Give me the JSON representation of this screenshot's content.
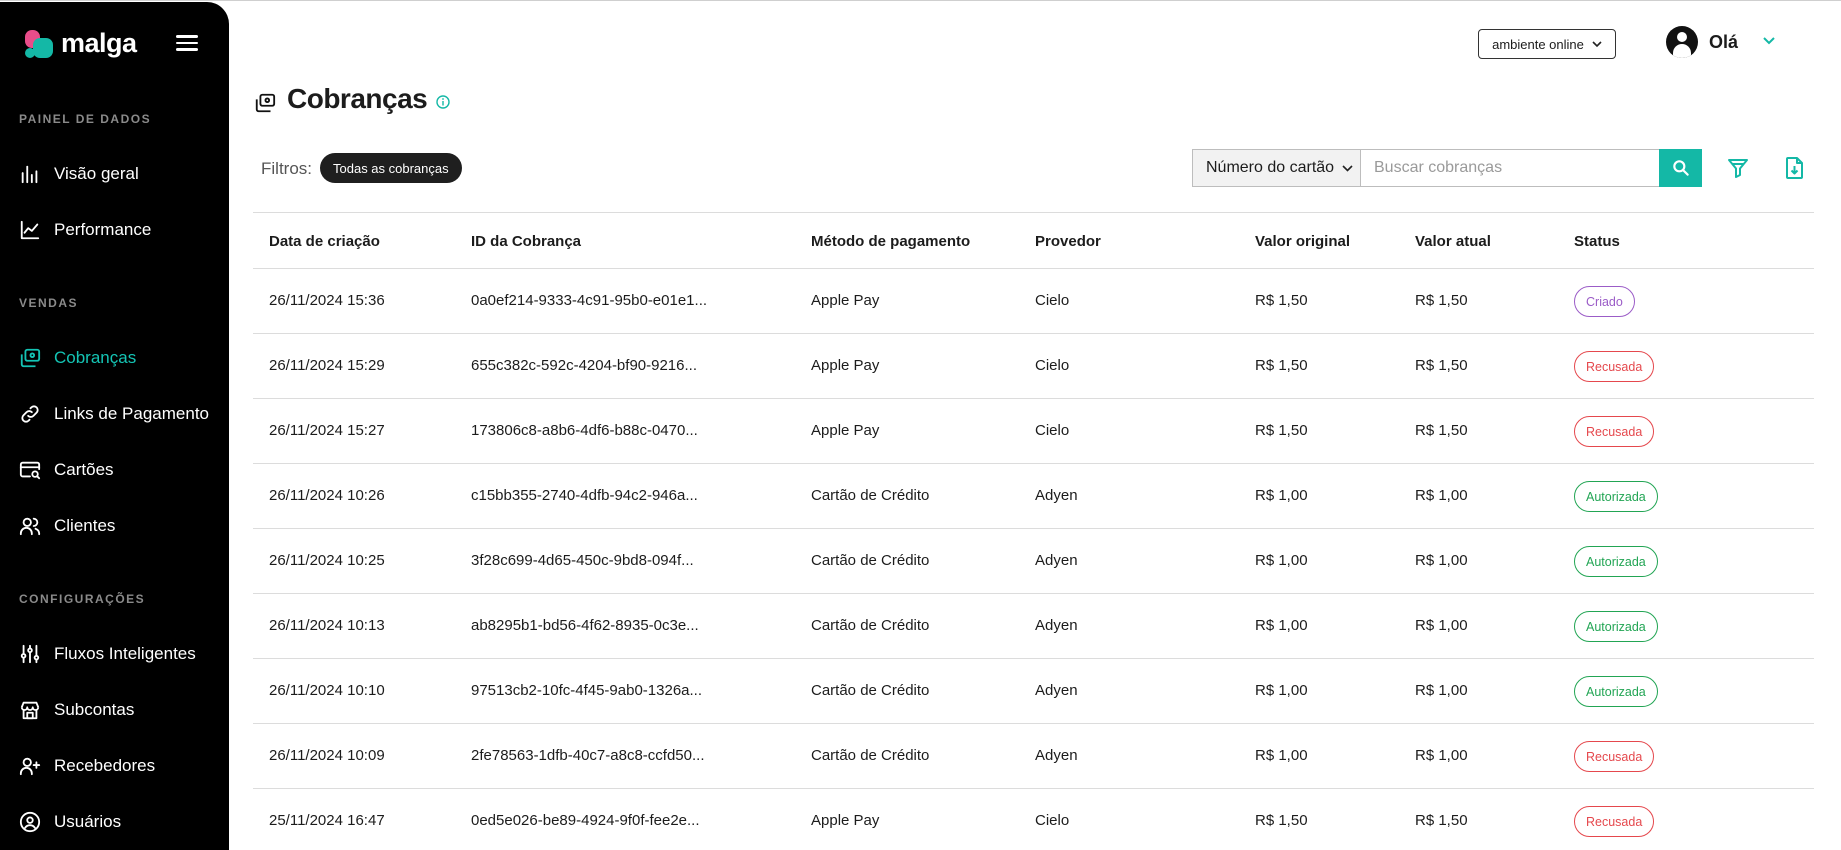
{
  "brand": {
    "name": "malga"
  },
  "colors": {
    "accent": "#14b8a6",
    "sidebar_bg": "#000000",
    "status_criado": "#9b5cc7",
    "status_recusada": "#e5484d",
    "status_autorizada": "#22a554"
  },
  "sidebar": {
    "sections": [
      {
        "title": "PAINEL DE DADOS",
        "items": [
          {
            "label": "Visão geral",
            "icon": "bar-chart-icon"
          },
          {
            "label": "Performance",
            "icon": "line-chart-icon"
          }
        ]
      },
      {
        "title": "VENDAS",
        "items": [
          {
            "label": "Cobranças",
            "icon": "charges-icon",
            "active": true
          },
          {
            "label": "Links de Pagamento",
            "icon": "link-icon"
          },
          {
            "label": "Cartões",
            "icon": "card-search-icon"
          },
          {
            "label": "Clientes",
            "icon": "users-icon"
          }
        ]
      },
      {
        "title": "CONFIGURAÇÕES",
        "items": [
          {
            "label": "Fluxos Inteligentes",
            "icon": "sliders-icon"
          },
          {
            "label": "Subcontas",
            "icon": "store-icon"
          },
          {
            "label": "Recebedores",
            "icon": "user-plus-icon"
          },
          {
            "label": "Usuários",
            "icon": "user-circle-icon"
          }
        ]
      }
    ]
  },
  "header": {
    "environment": "ambiente online",
    "greeting": "Olá"
  },
  "page": {
    "title": "Cobranças"
  },
  "filters": {
    "label": "Filtros:",
    "active_chip": "Todas as cobranças",
    "search_field": "Número do cartão",
    "search_placeholder": "Buscar cobranças"
  },
  "table": {
    "columns": [
      "Data de criação",
      "ID da Cobrança",
      "Método de pagamento",
      "Provedor",
      "Valor original",
      "Valor atual",
      "Status"
    ],
    "rows": [
      {
        "date": "26/11/2024 15:36",
        "id": "0a0ef214-9333-4c91-95b0-e01e1...",
        "method": "Apple Pay",
        "provider": "Cielo",
        "original": "R$ 1,50",
        "current": "R$ 1,50",
        "status": "Criado",
        "status_type": "criado"
      },
      {
        "date": "26/11/2024 15:29",
        "id": "655c382c-592c-4204-bf90-9216...",
        "method": "Apple Pay",
        "provider": "Cielo",
        "original": "R$ 1,50",
        "current": "R$ 1,50",
        "status": "Recusada",
        "status_type": "recusada"
      },
      {
        "date": "26/11/2024 15:27",
        "id": "173806c8-a8b6-4df6-b88c-0470...",
        "method": "Apple Pay",
        "provider": "Cielo",
        "original": "R$ 1,50",
        "current": "R$ 1,50",
        "status": "Recusada",
        "status_type": "recusada"
      },
      {
        "date": "26/11/2024 10:26",
        "id": "c15bb355-2740-4dfb-94c2-946a...",
        "method": "Cartão de Crédito",
        "provider": "Adyen",
        "original": "R$ 1,00",
        "current": "R$ 1,00",
        "status": "Autorizada",
        "status_type": "autorizada"
      },
      {
        "date": "26/11/2024 10:25",
        "id": "3f28c699-4d65-450c-9bd8-094f...",
        "method": "Cartão de Crédito",
        "provider": "Adyen",
        "original": "R$ 1,00",
        "current": "R$ 1,00",
        "status": "Autorizada",
        "status_type": "autorizada"
      },
      {
        "date": "26/11/2024 10:13",
        "id": "ab8295b1-bd56-4f62-8935-0c3e...",
        "method": "Cartão de Crédito",
        "provider": "Adyen",
        "original": "R$ 1,00",
        "current": "R$ 1,00",
        "status": "Autorizada",
        "status_type": "autorizada"
      },
      {
        "date": "26/11/2024 10:10",
        "id": "97513cb2-10fc-4f45-9ab0-1326a...",
        "method": "Cartão de Crédito",
        "provider": "Adyen",
        "original": "R$ 1,00",
        "current": "R$ 1,00",
        "status": "Autorizada",
        "status_type": "autorizada"
      },
      {
        "date": "26/11/2024 10:09",
        "id": "2fe78563-1dfb-40c7-a8c8-ccfd50...",
        "method": "Cartão de Crédito",
        "provider": "Adyen",
        "original": "R$ 1,00",
        "current": "R$ 1,00",
        "status": "Recusada",
        "status_type": "recusada"
      },
      {
        "date": "25/11/2024 16:47",
        "id": "0ed5e026-be89-4924-9f0f-fee2e...",
        "method": "Apple Pay",
        "provider": "Cielo",
        "original": "R$ 1,50",
        "current": "R$ 1,50",
        "status": "Recusada",
        "status_type": "recusada"
      }
    ]
  }
}
